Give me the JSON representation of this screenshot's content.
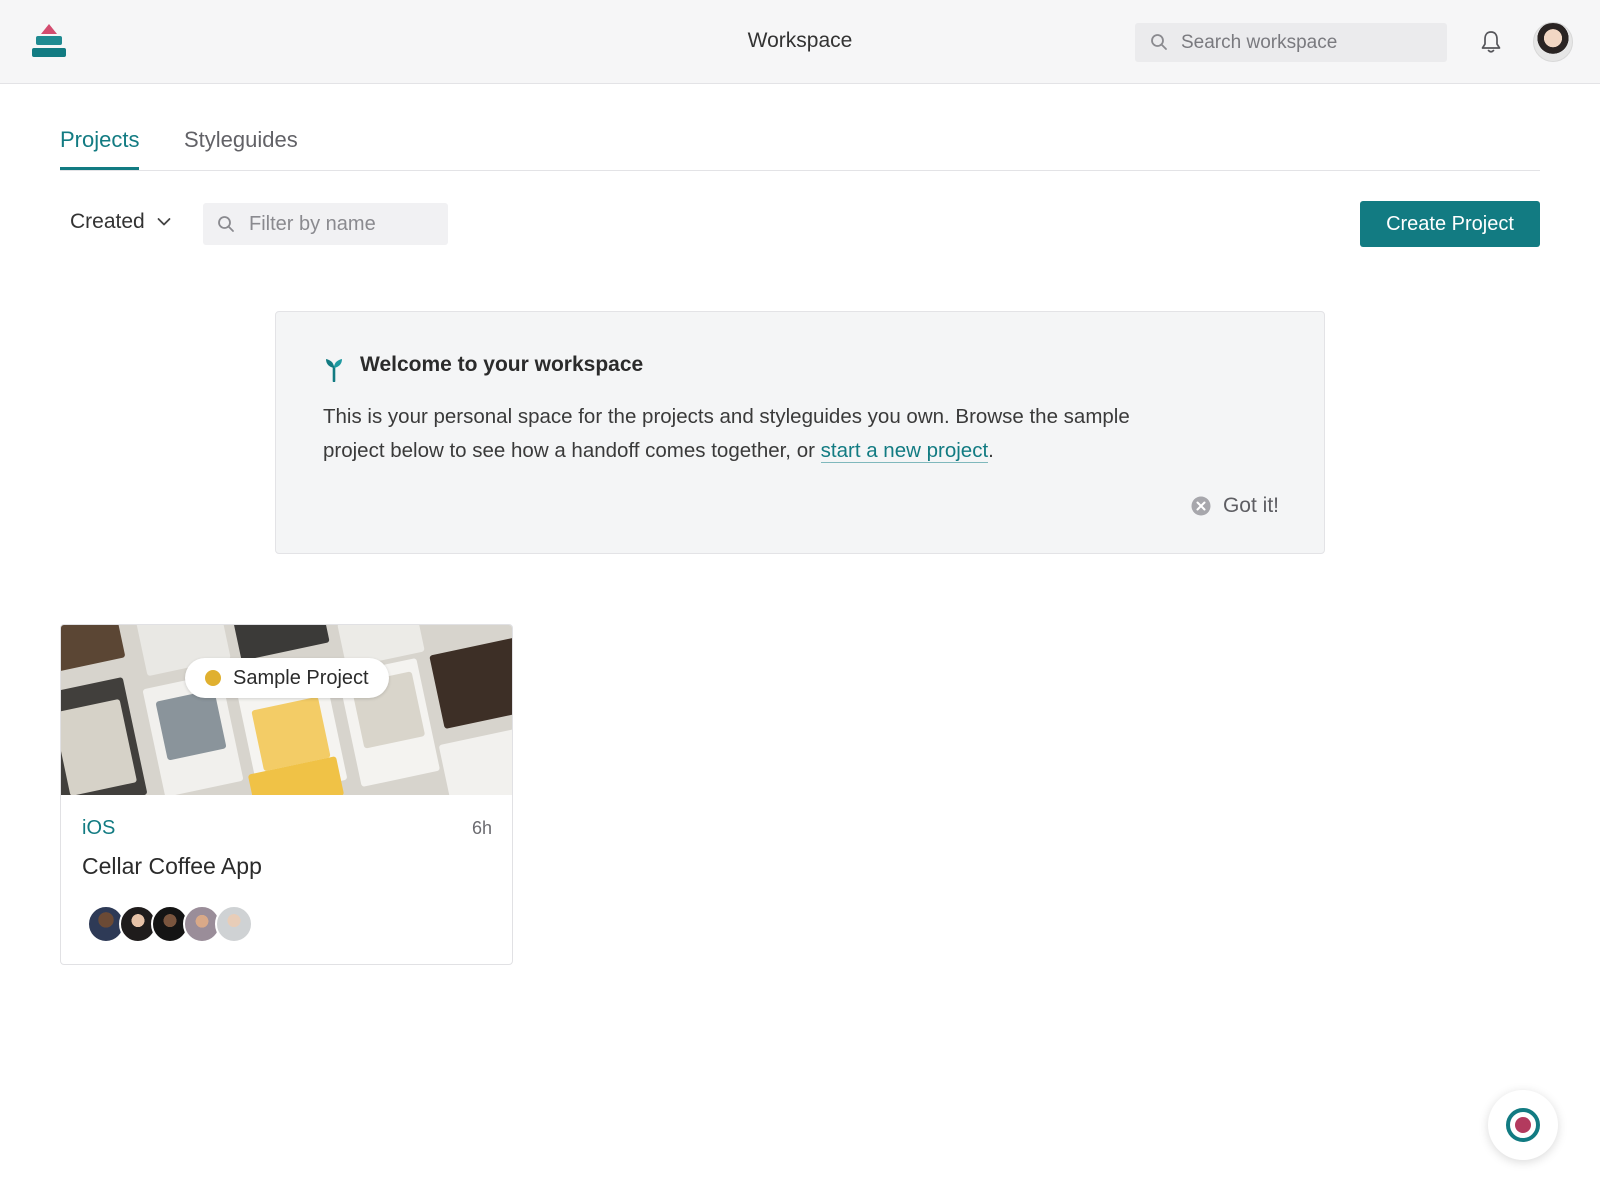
{
  "header": {
    "title": "Workspace",
    "search_placeholder": "Search workspace",
    "logo_icon": "zeplin-logo-icon",
    "notification_icon": "bell-icon",
    "avatar_icon": "user-avatar"
  },
  "tabs": [
    {
      "label": "Projects",
      "active": true
    },
    {
      "label": "Styleguides",
      "active": false
    }
  ],
  "toolbar": {
    "sort_label": "Created",
    "filter_placeholder": "Filter by name",
    "create_button": "Create Project"
  },
  "welcome": {
    "title": "Welcome to your workspace",
    "body_before": "This is your personal space for the projects and styleguides you own. Browse the sample project below to see how a handoff comes together, or ",
    "link_text": "start a new project",
    "body_after": ".",
    "dismiss_label": "Got it!"
  },
  "projects": [
    {
      "badge": "Sample Project",
      "platform": "iOS",
      "age": "6h",
      "name": "Cellar Coffee App",
      "members": [
        "member-1",
        "member-2",
        "member-3",
        "member-4",
        "member-5"
      ]
    }
  ],
  "colors": {
    "accent": "#127b82",
    "badge_dot": "#e0b02f",
    "help_core": "#b33a5e"
  }
}
